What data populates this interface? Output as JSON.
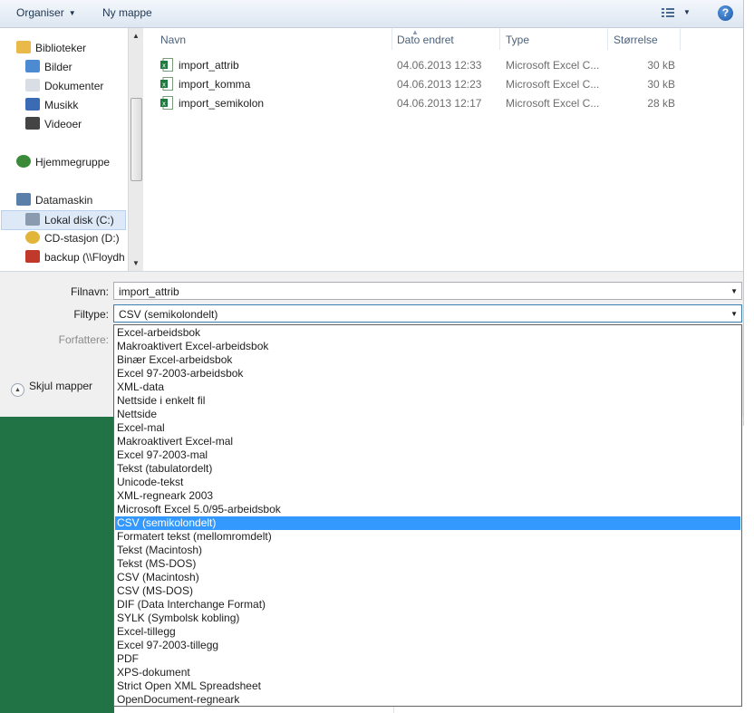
{
  "toolbar": {
    "organize_label": "Organiser",
    "new_folder_label": "Ny mappe",
    "help_label": "?"
  },
  "nav": {
    "items": [
      {
        "label": "Biblioteker",
        "icon": "libraries-icon"
      },
      {
        "label": "Bilder",
        "icon": "pictures-icon"
      },
      {
        "label": "Dokumenter",
        "icon": "documents-icon"
      },
      {
        "label": "Musikk",
        "icon": "music-icon"
      },
      {
        "label": "Videoer",
        "icon": "videos-icon"
      },
      {
        "label": "Hjemmegruppe",
        "icon": "homegroup-icon"
      },
      {
        "label": "Datamaskin",
        "icon": "computer-icon"
      },
      {
        "label": "Lokal disk (C:)",
        "icon": "local-disk-icon"
      },
      {
        "label": "CD-stasjon (D:)",
        "icon": "cd-drive-icon"
      },
      {
        "label": "backup (\\\\Floydh",
        "icon": "network-drive-icon"
      }
    ],
    "selected": "Lokal disk (C:)"
  },
  "filelist": {
    "columns": [
      "Navn",
      "Dato endret",
      "Type",
      "Størrelse"
    ],
    "rows": [
      {
        "name": "import_attrib",
        "date": "04.06.2013 12:33",
        "type": "Microsoft Excel C...",
        "size": "30 kB"
      },
      {
        "name": "import_komma",
        "date": "04.06.2013 12:23",
        "type": "Microsoft Excel C...",
        "size": "30 kB"
      },
      {
        "name": "import_semikolon",
        "date": "04.06.2013 12:17",
        "type": "Microsoft Excel C...",
        "size": "28 kB"
      }
    ]
  },
  "form": {
    "filename_label": "Filnavn:",
    "filename_value": "import_attrib",
    "filetype_label": "Filtype:",
    "filetype_value": "CSV (semikolondelt)",
    "authors_label": "Forfattere:",
    "hide_folders_label": "Skjul mapper"
  },
  "filetype_options": [
    "Excel-arbeidsbok",
    "Makroaktivert Excel-arbeidsbok",
    "Binær Excel-arbeidsbok",
    "Excel 97-2003-arbeidsbok",
    "XML-data",
    "Nettside i enkelt fil",
    "Nettside",
    "Excel-mal",
    "Makroaktivert Excel-mal",
    "Excel 97-2003-mal",
    "Tekst (tabulatordelt)",
    "Unicode-tekst",
    "XML-regneark 2003",
    "Microsoft Excel 5.0/95-arbeidsbok",
    "CSV (semikolondelt)",
    "Formatert tekst (mellomromdelt)",
    "Tekst (Macintosh)",
    "Tekst (MS-DOS)",
    "CSV (Macintosh)",
    "CSV (MS-DOS)",
    "DIF (Data Interchange Format)",
    "SYLK (Symbolsk kobling)",
    "Excel-tillegg",
    "Excel 97-2003-tillegg",
    "PDF",
    "XPS-dokument",
    "Strict Open XML Spreadsheet",
    "OpenDocument-regneark"
  ],
  "selected_filetype": "CSV (semikolondelt)",
  "colors": {
    "selection": "#3399ff",
    "excel_green": "#217346",
    "nav_selected": "#dde9f7"
  }
}
